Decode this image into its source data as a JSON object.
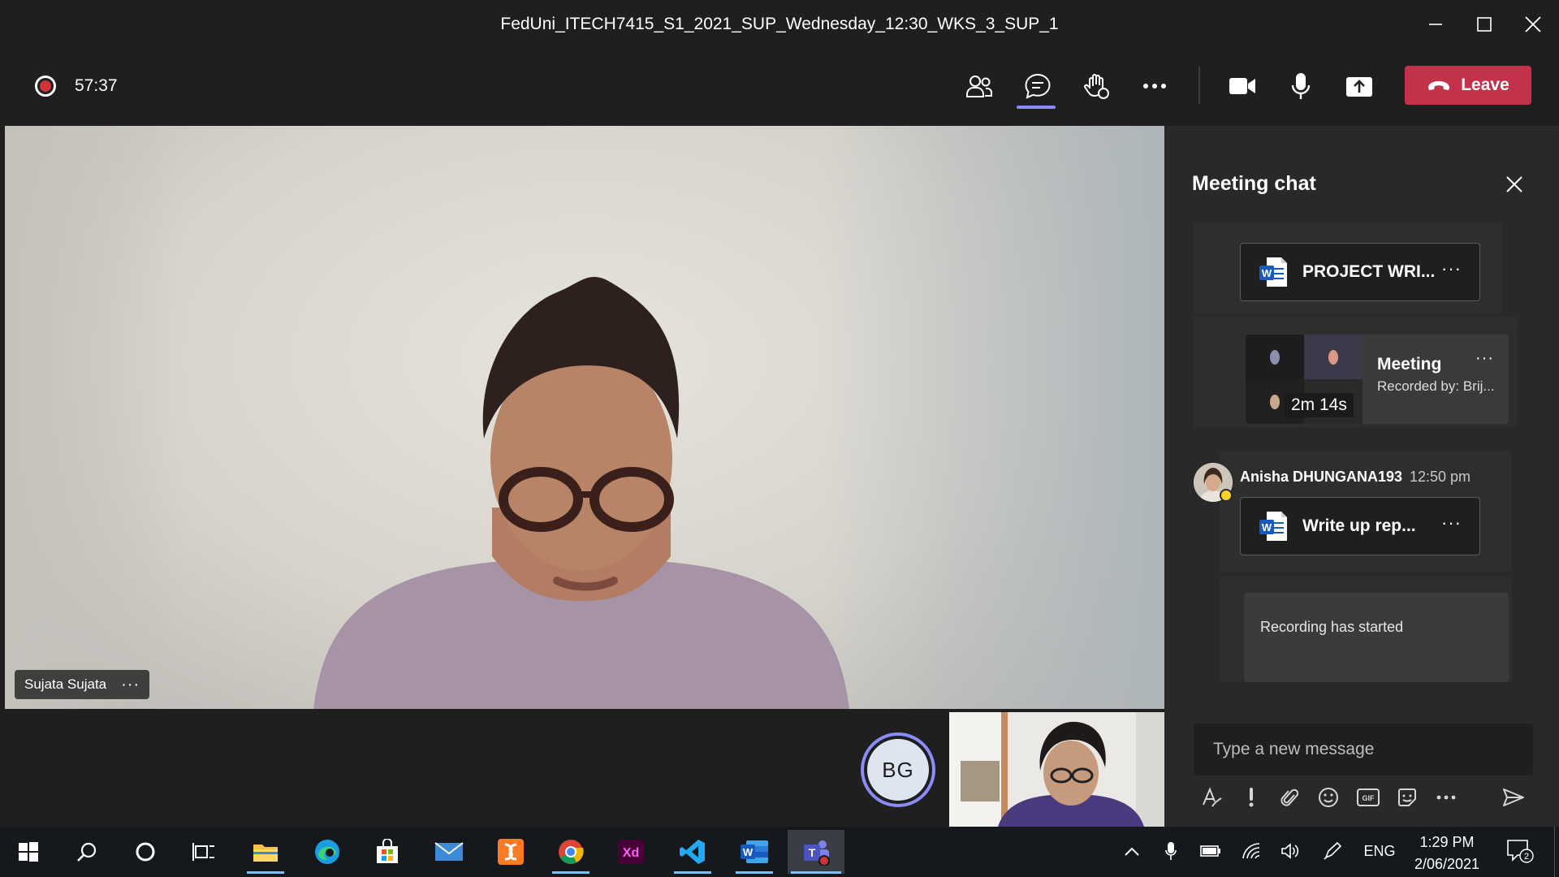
{
  "window": {
    "title": "FedUni_ITECH7415_S1_2021_SUP_Wednesday_12:30_WKS_3_SUP_1"
  },
  "toolbar": {
    "timer": "57:37",
    "leave_label": "Leave",
    "icons": [
      "people-icon",
      "chat-icon",
      "raise-hand-icon",
      "more-icon",
      "camera-icon",
      "microphone-icon",
      "share-icon",
      "phone-icon"
    ]
  },
  "video": {
    "participant_name": "Sujata Sujata",
    "more_label": "···"
  },
  "bottom": {
    "avatar_initials": "BG"
  },
  "chat": {
    "title": "Meeting chat",
    "messages": [
      {
        "type": "file",
        "name": "PROJECT WRI...",
        "more": "···"
      },
      {
        "type": "recording",
        "title": "Meeting",
        "subtitle": "Recorded by: Brij...",
        "duration": "2m 14s",
        "more": "···"
      },
      {
        "type": "file",
        "sender": "Anisha DHUNGANA193",
        "time": "12:50 pm",
        "name": "Write up rep...",
        "more": "···"
      },
      {
        "type": "system",
        "text": "Recording has started"
      }
    ],
    "compose_placeholder": "Type a new message",
    "compose_icons": [
      "format-icon",
      "important-icon",
      "attach-icon",
      "emoji-icon",
      "gif-icon",
      "sticker-icon",
      "more-icon",
      "send-icon"
    ]
  },
  "taskbar": {
    "apps": [
      "windows-start",
      "search",
      "cortana",
      "task-view",
      "file-explorer",
      "edge",
      "store",
      "mail",
      "xampp",
      "chrome",
      "adobe-xd",
      "vscode",
      "word",
      "teams"
    ],
    "xd_label": "Xd",
    "gif_label": "GIF",
    "language": "ENG",
    "time": "1:29 PM",
    "date": "2/06/2021",
    "notification_count": "2"
  },
  "colors": {
    "accent": "#8b8cf7",
    "leave": "#c4314b",
    "record": "#d13438",
    "panel": "#292929",
    "background": "#1f1f1f"
  }
}
